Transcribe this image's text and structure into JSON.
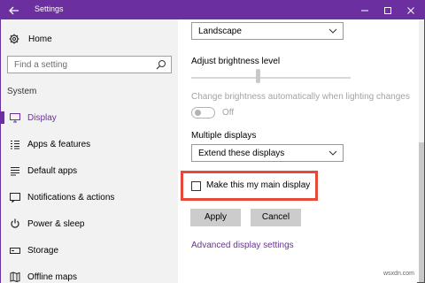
{
  "window": {
    "title": "Settings"
  },
  "sidebar": {
    "home_label": "Home",
    "search_placeholder": "Find a setting",
    "section_label": "System",
    "items": [
      {
        "label": "Display",
        "icon": "monitor-icon",
        "active": true
      },
      {
        "label": "Apps & features",
        "icon": "apps-list-icon"
      },
      {
        "label": "Default apps",
        "icon": "default-apps-icon"
      },
      {
        "label": "Notifications & actions",
        "icon": "notifications-icon"
      },
      {
        "label": "Power & sleep",
        "icon": "power-icon"
      },
      {
        "label": "Storage",
        "icon": "storage-icon"
      },
      {
        "label": "Offline maps",
        "icon": "map-icon"
      }
    ]
  },
  "main": {
    "orientation_value": "Landscape",
    "brightness_label": "Adjust brightness level",
    "brightness_level": 0.42,
    "auto_brightness_label": "Change brightness automatically when lighting changes",
    "auto_brightness_state": "Off",
    "multiple_displays_label": "Multiple displays",
    "multiple_displays_value": "Extend these displays",
    "main_display_checkbox_label": "Make this my main display",
    "main_display_checked": false,
    "apply_label": "Apply",
    "cancel_label": "Cancel",
    "advanced_link": "Advanced display settings"
  },
  "watermark": "wsxdn.com",
  "colors": {
    "accent": "#6b2fa0",
    "highlight": "#e6493a",
    "sidebar_bg": "#f2f2f2"
  }
}
